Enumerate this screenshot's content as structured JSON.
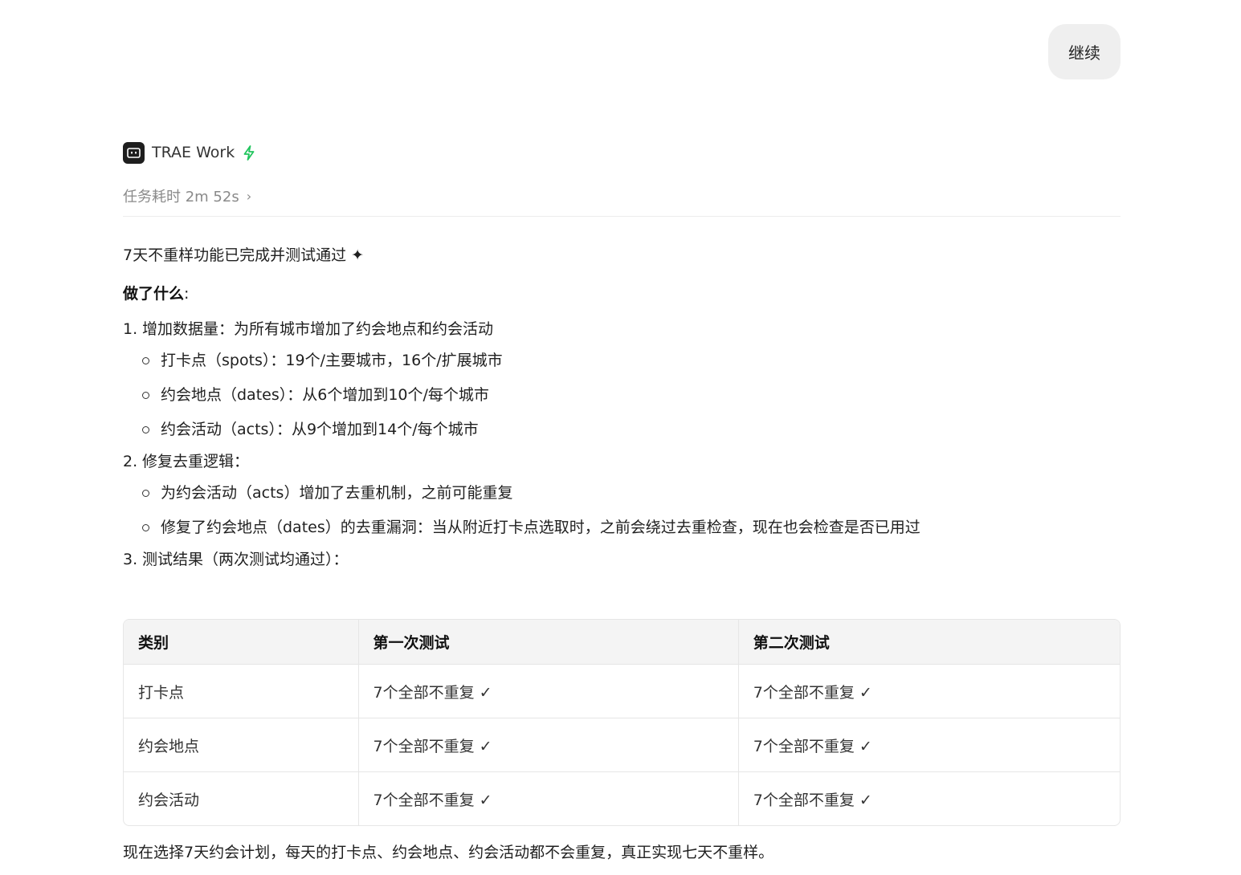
{
  "user_message": {
    "text": "继续"
  },
  "agent": {
    "name": "TRAE Work",
    "logo_icon": "robot-icon",
    "badge_icon": "bolt-icon",
    "badge_color": "#22c55e"
  },
  "task": {
    "duration_label": "任务耗时 2m 52s",
    "chevron": "›"
  },
  "summary": "7天不重样功能已完成并测试通过 ✦",
  "what_done": {
    "heading": "做了什么",
    "colon": ":"
  },
  "steps": [
    {
      "num": "1.",
      "title": "增加数据量：为所有城市增加了约会地点和约会活动",
      "subs": [
        "打卡点（spots）：19个/主要城市，16个/扩展城市",
        "约会地点（dates）：从6个增加到10个/每个城市",
        "约会活动（acts）：从9个增加到14个/每个城市"
      ]
    },
    {
      "num": "2.",
      "title": "修复去重逻辑：",
      "subs": [
        "为约会活动（acts）增加了去重机制，之前可能重复",
        "修复了约会地点（dates）的去重漏洞：当从附近打卡点选取时，之前会绕过去重检查，现在也会检查是否已用过"
      ]
    },
    {
      "num": "3.",
      "title": "测试结果（两次测试均通过）：",
      "subs": []
    }
  ],
  "table": {
    "headers": [
      "类别",
      "第一次测试",
      "第二次测试"
    ],
    "rows": [
      [
        "打卡点",
        "7个全部不重复 ✓",
        "7个全部不重复 ✓"
      ],
      [
        "约会地点",
        "7个全部不重复 ✓",
        "7个全部不重复 ✓"
      ],
      [
        "约会活动",
        "7个全部不重复 ✓",
        "7个全部不重复 ✓"
      ]
    ]
  },
  "footer": "现在选择7天约会计划，每天的打卡点、约会地点、约会活动都不会重复，真正实现七天不重样。"
}
